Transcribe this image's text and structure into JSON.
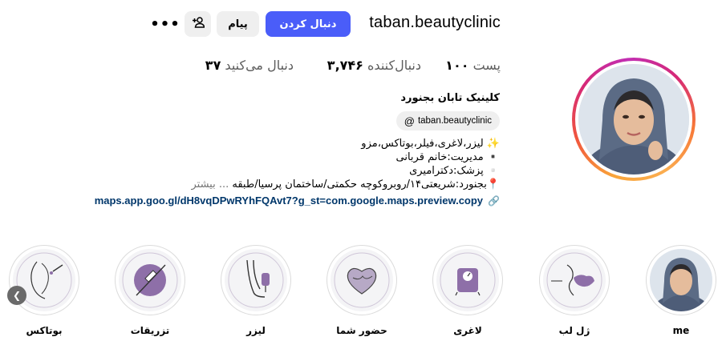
{
  "profile": {
    "username": "taban.beautyclinic",
    "full_name": "کلینیک تابان بجنورد",
    "threads_handle": "taban.beautyclinic"
  },
  "actions": {
    "follow_label": "دنبال کردن",
    "message_label": "پیام",
    "more_label": "•••",
    "follow_color": "#4a5df9"
  },
  "stats": {
    "posts": {
      "value": "۱۰۰",
      "label": "پست"
    },
    "followers": {
      "value": "۳,۷۴۶",
      "label": "دنبال‌کننده"
    },
    "following": {
      "value": "۳۷",
      "label": "دنبال می‌کنید"
    }
  },
  "bio": {
    "lines": [
      "✨ لیزر،لاغری،فیلر،بوتاکس،مزو",
      "▪️ مدیریت:خانم قربانی",
      "▫️ پزشک:دکترامیری",
      "📍بجنورد:شریعتی۱۴/روبروکوچه حکمتی/ساختمان پرسیا/طبقه"
    ],
    "more_label": "... بیشتر"
  },
  "link": {
    "url": "maps.app.goo.gl/dH8vqDPwRYhFQAvt7?g_st=com.google.maps.preview.copy"
  },
  "highlights": [
    {
      "label": "me",
      "icon": "portrait-photo"
    },
    {
      "label": "ژل لب",
      "icon": "lips-icon"
    },
    {
      "label": "لاغری",
      "icon": "scale-icon"
    },
    {
      "label": "حضور شما",
      "icon": "heart-icon"
    },
    {
      "label": "لیزر",
      "icon": "laser-leg-icon"
    },
    {
      "label": "تزریقات",
      "icon": "syringe-icon"
    },
    {
      "label": "بوتاکس",
      "icon": "face-injection-icon"
    }
  ],
  "colors": {
    "accent": "#4a5df9",
    "link": "#00376b",
    "highlight_purple": "#8e6fa8"
  }
}
